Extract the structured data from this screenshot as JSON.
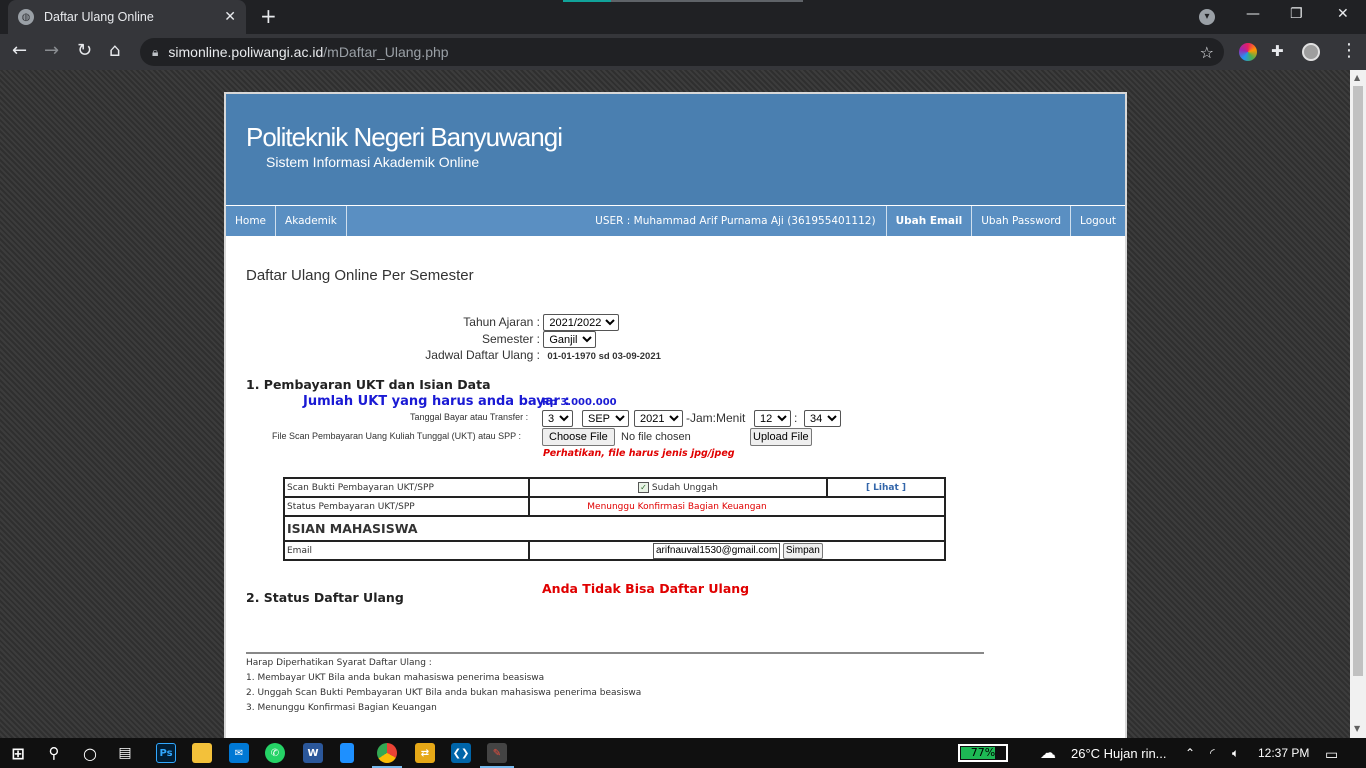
{
  "browser": {
    "tab_title": "Daftar Ulang Online",
    "url_host": "simonline.poliwangi.ac.id",
    "url_path": "/mDaftar_Ulang.php"
  },
  "site": {
    "name": "Politeknik Negeri Banyuwangi",
    "subtitle": "Sistem Informasi Akademik Online"
  },
  "menu": {
    "home": "Home",
    "akademik": "Akademik",
    "user": "USER : Muhammad Arif Purnama Aji (361955401112)",
    "ubah_email": "Ubah Email",
    "ubah_password": "Ubah Password",
    "logout": "Logout"
  },
  "page": {
    "title": "Daftar Ulang Online Per Semester",
    "tahun_ajaran_label": "Tahun Ajaran :",
    "tahun_ajaran_value": "2021/2022",
    "semester_label": "Semester :",
    "semester_value": "Ganjil",
    "jadwal_label": "Jadwal Daftar Ulang :",
    "jadwal_value": "01-01-1970 sd 03-09-2021"
  },
  "section1": {
    "title": "1. Pembayaran UKT dan Isian Data",
    "ukt_label": "Jumlah UKT yang harus anda bayar :",
    "ukt_amount": "Rp 3.000.000",
    "tanggal_label": "Tanggal Bayar atau Transfer :",
    "day": "3",
    "month": "SEP",
    "year": "2021",
    "jam_label": "-Jam:Menit",
    "hour": "12",
    "colon": ":",
    "minute": "34",
    "file_label": "File Scan Pembayaran Uang Kuliah Tunggal (UKT) atau SPP :",
    "choose_file": "Choose File",
    "no_file": "No file chosen",
    "upload_button": "Upload File",
    "warning": "Perhatikan, file harus jenis jpg/jpeg"
  },
  "table": {
    "scan_label": "Scan Bukti Pembayaran UKT/SPP",
    "scan_status": "Sudah Unggah",
    "lihat": "[ Lihat ]",
    "status_label": "Status Pembayaran UKT/SPP",
    "status_value": "Menunggu Konfirmasi Bagian Keuangan",
    "isian_heading": "ISIAN MAHASISWA",
    "email_label": "Email",
    "email_value": "arifnauval1530@gmail.com",
    "simpan": "Simpan"
  },
  "section2": {
    "title": "2. Status Daftar Ulang",
    "message": "Anda Tidak Bisa Daftar Ulang"
  },
  "notes": {
    "heading": "Harap Diperhatikan Syarat Daftar Ulang :",
    "items": [
      "1. Membayar UKT Bila anda bukan mahasiswa penerima beasiswa",
      "2. Unggah Scan Bukti Pembayaran UKT Bila anda bukan mahasiswa penerima beasiswa",
      "3. Menunggu Konfirmasi Bagian Keuangan"
    ]
  },
  "taskbar": {
    "battery": "77%",
    "battery_level": 0.77,
    "weather": "26°C  Hujan rin...",
    "time": "12:37 PM"
  }
}
